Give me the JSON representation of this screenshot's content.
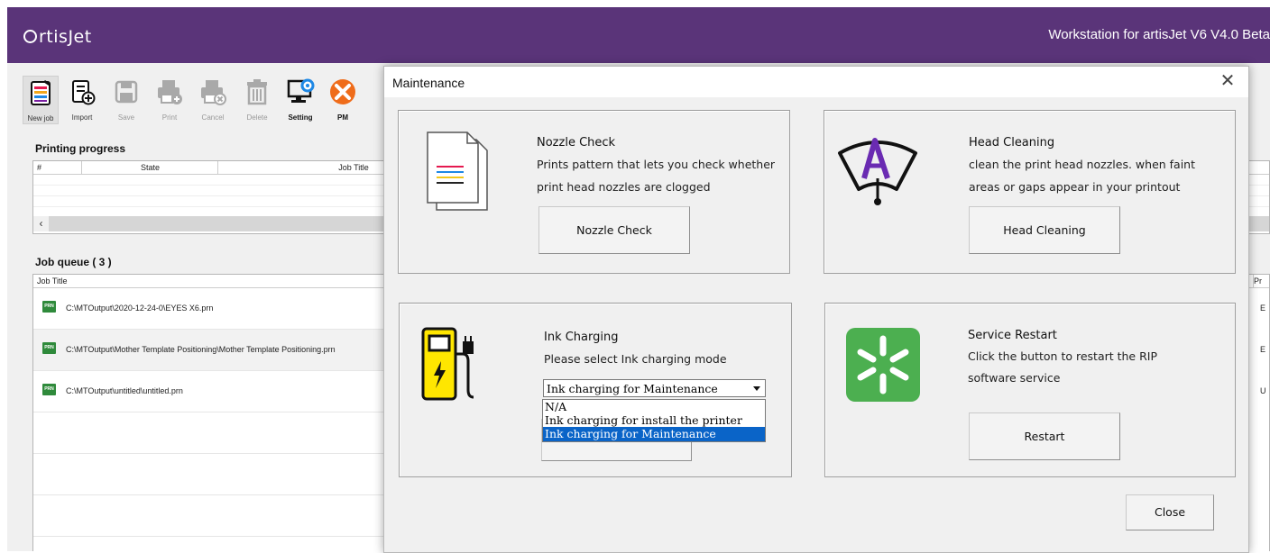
{
  "app": {
    "logo_text": "rtisJet",
    "title": "Workstation for artisJet V6 V4.0 Beta"
  },
  "toolbar": {
    "new_job": "New job",
    "import": "Import",
    "save": "Save",
    "print": "Print",
    "cancel": "Cancel",
    "delete": "Delete",
    "setting": "Setting",
    "pm": "PM"
  },
  "printing_progress": {
    "heading": "Printing progress",
    "columns": [
      "#",
      "State",
      "Job Title"
    ]
  },
  "job_queue": {
    "heading": "Job queue ( 3 )",
    "column_job_title": "Job Title",
    "column_right": "Pr",
    "rows": [
      {
        "badge": "PRN",
        "path": "C:\\MTOutput\\2020-12-24-0\\EYES X6.prn",
        "right": "E"
      },
      {
        "badge": "PRN",
        "path": "C:\\MTOutput\\Mother Template Positioning\\Mother Template Positioning.prn",
        "right": "E"
      },
      {
        "badge": "PRN",
        "path": "C:\\MTOutput\\untitled\\untitled.prn",
        "right": "U"
      }
    ]
  },
  "dialog": {
    "title": "Maintenance",
    "nozzle": {
      "title": "Nozzle Check",
      "desc1": "Prints pattern that lets you check whether",
      "desc2": "print head nozzles are clogged",
      "button": "Nozzle Check"
    },
    "head": {
      "title": "Head Cleaning",
      "desc1": "clean the print head nozzles.  when faint",
      "desc2": "areas or gaps appear in your printout",
      "button": "Head Cleaning"
    },
    "ink": {
      "title": "Ink Charging",
      "desc": "Please select Ink charging mode",
      "selected": "Ink charging for Maintenance",
      "options": [
        "N/A",
        "Ink charging for install the printer",
        "Ink charging for Maintenance"
      ]
    },
    "service": {
      "title": "Service Restart",
      "desc1": "Click the button to restart the RIP",
      "desc2": "software service",
      "button": "Restart"
    },
    "close_button": "Close"
  },
  "colors": {
    "titlebar": "#5a3479",
    "selection": "#0a64c8",
    "restart_icon_bg": "#4caf50"
  }
}
